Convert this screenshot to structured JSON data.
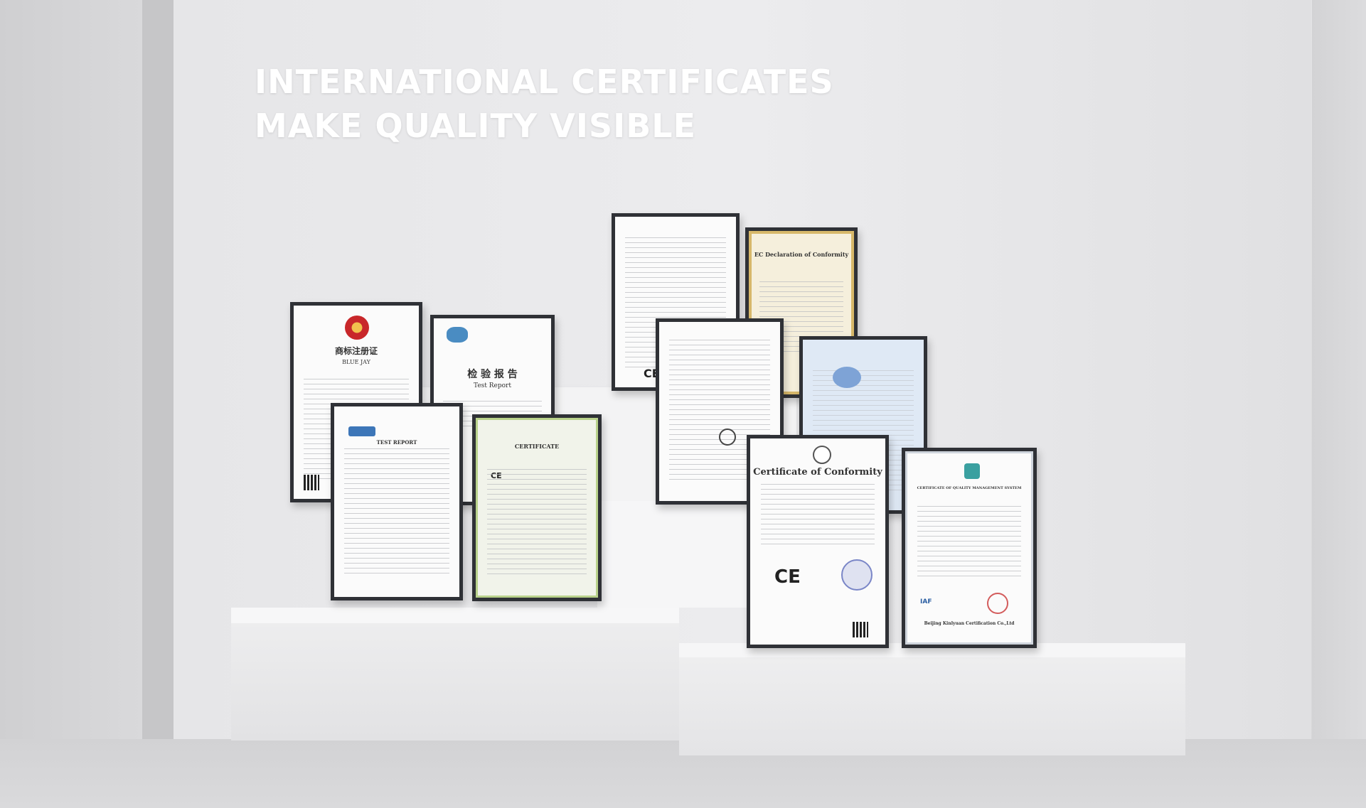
{
  "headline": {
    "line1": "INTERNATIONAL CERTIFICATES",
    "line2": "MAKE QUALITY VISIBLE"
  },
  "certificates": {
    "trademark": {
      "heading": "商标注册证",
      "brand": "BLUE JAY"
    },
    "inspection": {
      "heading": "检 验 报 告",
      "subheading": "Test Report"
    },
    "ec_declaration": {
      "heading": "EC Declaration of Conformity"
    },
    "conformity": {
      "heading": "Certificate of Conformity",
      "mark": "CE"
    },
    "quality_system": {
      "heading": "CERTIFICATE OF QUALITY MANAGEMENT SYSTEM",
      "issuer": "Beijing Kinlyuan Certification Co.,Ltd",
      "marks": "IAF"
    },
    "ce_certificate": {
      "heading": "CERTIFICATE",
      "mark": "CE"
    },
    "test_report": {
      "heading": "TEST REPORT"
    }
  },
  "colors": {
    "wall": "#e1e1e3",
    "frame": "#2f3136",
    "text": "#ffffff"
  }
}
